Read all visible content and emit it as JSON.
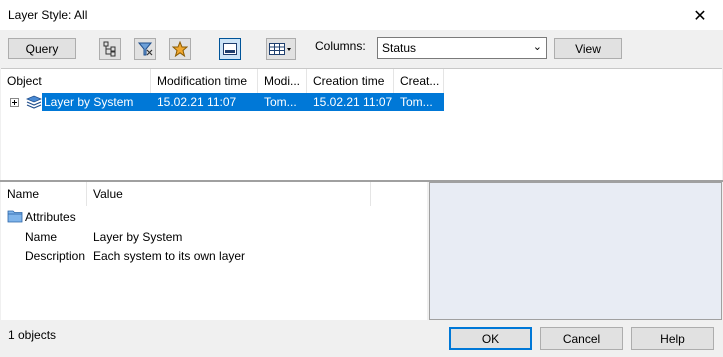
{
  "window": {
    "title": "Layer Style: All",
    "close_glyph": "✕"
  },
  "toolbar": {
    "query_label": "Query",
    "columns_label": "Columns:",
    "columns_value": "Status",
    "view_label": "View",
    "icons": [
      "tree-structure-icon",
      "filter-select-icon",
      "favorite-star-icon",
      "preview-pane-icon",
      "table-columns-dropdown-icon"
    ]
  },
  "tree": {
    "columns": [
      "Object",
      "Modification time",
      "Modi...",
      "Creation time",
      "Creat..."
    ],
    "rows": [
      {
        "object": "Layer by System",
        "mod_time": "15.02.21  11:07",
        "mod_by": "Tom...",
        "create_time": "15.02.21  11:07",
        "create_by": "Tom..."
      }
    ]
  },
  "properties": {
    "columns": [
      "Name",
      "Value"
    ],
    "group": "Attributes",
    "items": [
      {
        "name": "Name",
        "value": "Layer by System"
      },
      {
        "name": "Description",
        "value": "Each system to its own layer"
      }
    ]
  },
  "status": {
    "text": "1 objects"
  },
  "buttons": {
    "ok": "OK",
    "cancel": "Cancel",
    "help": "Help"
  },
  "colors": {
    "selection": "#0078d7",
    "preview_bg": "#e8ecf4",
    "accent_border": "#005499"
  }
}
